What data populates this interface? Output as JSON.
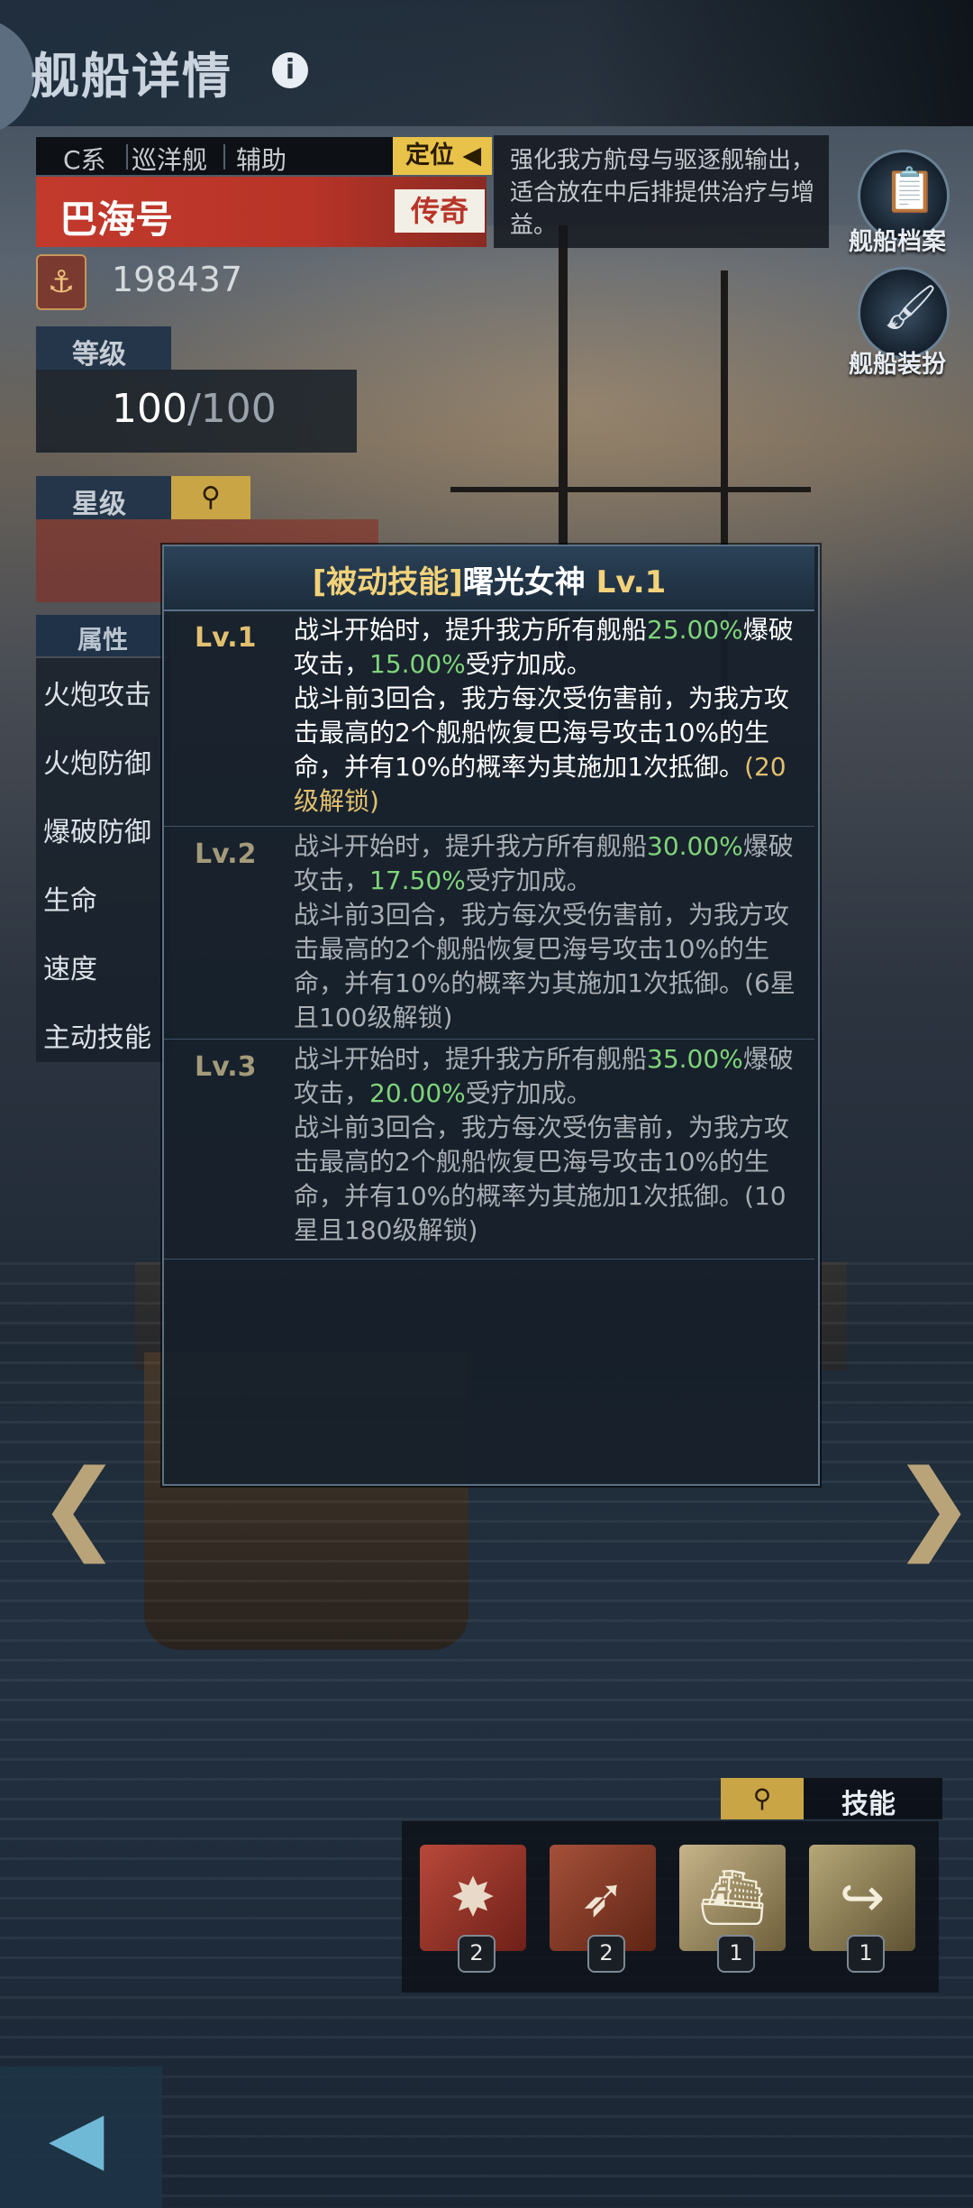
{
  "header": {
    "title": "舰船详情",
    "info_icon": "i"
  },
  "ship": {
    "tags": [
      "C系",
      "巡洋舰",
      "辅助"
    ],
    "role_label": "定位",
    "role_desc": "强化我方航母与驱逐舰输出，适合放在中后排提供治疗与增益。",
    "name": "巴海号",
    "rarity": "传奇",
    "power": "198437",
    "level_label": "等级",
    "level_current": "100",
    "level_max": "/100",
    "star_label": "星级"
  },
  "attributes": {
    "header": "属性",
    "items": [
      "火炮攻击",
      "火炮防御",
      "爆破防御",
      "生命",
      "速度",
      "主动技能"
    ]
  },
  "side_buttons": {
    "archive": "舰船档案",
    "skin": "舰船装扮"
  },
  "popup": {
    "title_tag": "[被动技能]",
    "title_name": "曙光女神",
    "title_level": " Lv.1",
    "levels": [
      {
        "tag": "Lv.1",
        "p1": "战斗开始时，提升我方所有舰船",
        "v1": "25.00%",
        "p2": "爆破攻击，",
        "v2": "15.00%",
        "p3": "受疗加成。",
        "p4": "战斗前3回合，我方每次受伤害前，为我方攻击最高的2个舰船恢复巴海号攻击10%的生命，并有10%的概率为其施加1次抵御。",
        "lock": "(20级解锁)"
      },
      {
        "tag": "Lv.2",
        "p1": "战斗开始时，提升我方所有舰船",
        "v1": "30.00%",
        "p2": "爆破攻击，",
        "v2": "17.50%",
        "p3": "受疗加成。",
        "p4": "战斗前3回合，我方每次受伤害前，为我方攻击最高的2个舰船恢复巴海号攻击10%的生命，并有10%的概率为其施加1次抵御。",
        "lock": "(6星且100级解锁)"
      },
      {
        "tag": "Lv.3",
        "p1": "战斗开始时，提升我方所有舰船",
        "v1": "35.00%",
        "p2": "爆破攻击，",
        "v2": "20.00%",
        "p3": "受疗加成。",
        "p4": "战斗前3回合，我方每次受伤害前，为我方攻击最高的2个舰船恢复巴海号攻击10%的生命，并有10%的概率为其施加1次抵御。",
        "lock": "(10星且180级解锁)"
      }
    ]
  },
  "skills": {
    "label": "技能",
    "cards": [
      {
        "icon": "cannon-icon",
        "count": "2"
      },
      {
        "icon": "missile-icon",
        "count": "2"
      },
      {
        "icon": "ship-icon",
        "count": "1"
      },
      {
        "icon": "arrow-turn-icon",
        "count": "1"
      }
    ]
  },
  "colors": {
    "accent_gold": "#e9c24a",
    "name_red": "#c23a2c",
    "highlight_green": "#7fd47a",
    "lock_gold": "#e2c070"
  }
}
